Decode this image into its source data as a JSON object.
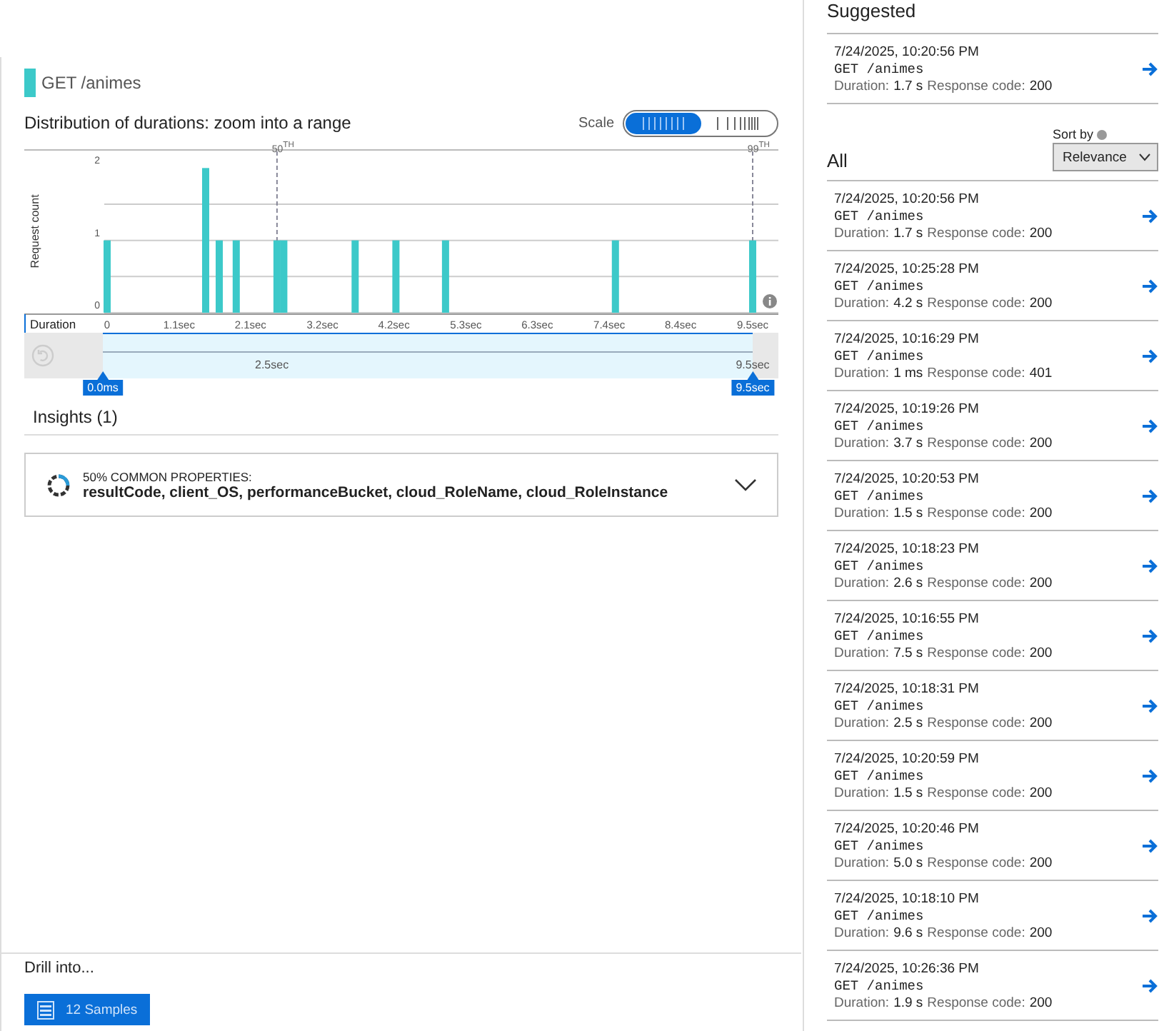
{
  "operation": {
    "title": "GET /animes",
    "color": "#3cc9c9"
  },
  "distribution": {
    "title": "Distribution of durations: zoom into a range",
    "scale": {
      "label": "Scale",
      "options": [
        {
          "kind": "linear",
          "selected": true
        },
        {
          "kind": "log",
          "selected": false
        }
      ]
    },
    "chart_data": {
      "type": "bar",
      "ylabel": "Request count",
      "xlabel": "Duration",
      "x": [
        0,
        1.45,
        1.65,
        1.9,
        2.5,
        2.6,
        3.65,
        4.25,
        4.98,
        7.48,
        9.5
      ],
      "values": [
        1,
        2,
        1,
        1,
        1,
        1,
        1,
        1,
        1,
        1,
        1
      ],
      "xlim": [
        0,
        9.5
      ],
      "ylim": [
        0,
        2.25
      ],
      "yticks": [
        0,
        1,
        2
      ],
      "xticks": [
        {
          "value": 0,
          "label": "0"
        },
        {
          "value": 1.06,
          "label": "1.1sec"
        },
        {
          "value": 2.11,
          "label": "2.1sec"
        },
        {
          "value": 3.17,
          "label": "3.2sec"
        },
        {
          "value": 4.22,
          "label": "4.2sec"
        },
        {
          "value": 5.28,
          "label": "5.3sec"
        },
        {
          "value": 6.33,
          "label": "6.3sec"
        },
        {
          "value": 7.39,
          "label": "7.4sec"
        },
        {
          "value": 8.44,
          "label": "8.4sec"
        },
        {
          "value": 9.5,
          "label": "9.5sec"
        }
      ],
      "ref_lines": [
        {
          "axis": "x",
          "value": 2.5,
          "label": "50$^{TH}$"
        },
        {
          "axis": "x",
          "value": 9.5,
          "label": "99$^{TH}$"
        }
      ]
    },
    "range": {
      "handles": [
        {
          "label": "0.0ms",
          "level": 0
        },
        {
          "label": "9.5sec",
          "level": 1
        }
      ],
      "marks": [
        "2.5sec",
        "9.5sec"
      ]
    }
  },
  "insights": {
    "title": "Insights (1)",
    "items": [
      {
        "heading": "50% COMMON PROPERTIES:",
        "properties": "resultCode, client_OS, performanceBucket, cloud_RoleName, cloud_RoleInstance",
        "expanded": false
      }
    ]
  },
  "drill": {
    "title": "Drill into...",
    "button": "12 Samples"
  },
  "suggested": {
    "title": "Suggested",
    "items": [
      {
        "time": "7/24/2025, 10:20:56 PM",
        "request": "GET /animes",
        "duration_label": "Duration:",
        "duration": "1.7 s",
        "code_label": "Response code:",
        "code": "200"
      }
    ]
  },
  "all": {
    "title": "All",
    "sort_label": "Sort by",
    "sort_value": "Relevance",
    "items": [
      {
        "time": "7/24/2025, 10:20:56 PM",
        "request": "GET /animes",
        "duration_label": "Duration:",
        "duration": "1.7 s",
        "code_label": "Response code:",
        "code": "200"
      },
      {
        "time": "7/24/2025, 10:25:28 PM",
        "request": "GET /animes",
        "duration_label": "Duration:",
        "duration": "4.2 s",
        "code_label": "Response code:",
        "code": "200"
      },
      {
        "time": "7/24/2025, 10:16:29 PM",
        "request": "GET /animes",
        "duration_label": "Duration:",
        "duration": "1 ms",
        "code_label": "Response code:",
        "code": "401"
      },
      {
        "time": "7/24/2025, 10:19:26 PM",
        "request": "GET /animes",
        "duration_label": "Duration:",
        "duration": "3.7 s",
        "code_label": "Response code:",
        "code": "200"
      },
      {
        "time": "7/24/2025, 10:20:53 PM",
        "request": "GET /animes",
        "duration_label": "Duration:",
        "duration": "1.5 s",
        "code_label": "Response code:",
        "code": "200"
      },
      {
        "time": "7/24/2025, 10:18:23 PM",
        "request": "GET /animes",
        "duration_label": "Duration:",
        "duration": "2.6 s",
        "code_label": "Response code:",
        "code": "200"
      },
      {
        "time": "7/24/2025, 10:16:55 PM",
        "request": "GET /animes",
        "duration_label": "Duration:",
        "duration": "7.5 s",
        "code_label": "Response code:",
        "code": "200"
      },
      {
        "time": "7/24/2025, 10:18:31 PM",
        "request": "GET /animes",
        "duration_label": "Duration:",
        "duration": "2.5 s",
        "code_label": "Response code:",
        "code": "200"
      },
      {
        "time": "7/24/2025, 10:20:59 PM",
        "request": "GET /animes",
        "duration_label": "Duration:",
        "duration": "1.5 s",
        "code_label": "Response code:",
        "code": "200"
      },
      {
        "time": "7/24/2025, 10:20:46 PM",
        "request": "GET /animes",
        "duration_label": "Duration:",
        "duration": "5.0 s",
        "code_label": "Response code:",
        "code": "200"
      },
      {
        "time": "7/24/2025, 10:18:10 PM",
        "request": "GET /animes",
        "duration_label": "Duration:",
        "duration": "9.6 s",
        "code_label": "Response code:",
        "code": "200"
      },
      {
        "time": "7/24/2025, 10:26:36 PM",
        "request": "GET /animes",
        "duration_label": "Duration:",
        "duration": "1.9 s",
        "code_label": "Response code:",
        "code": "200"
      }
    ]
  }
}
